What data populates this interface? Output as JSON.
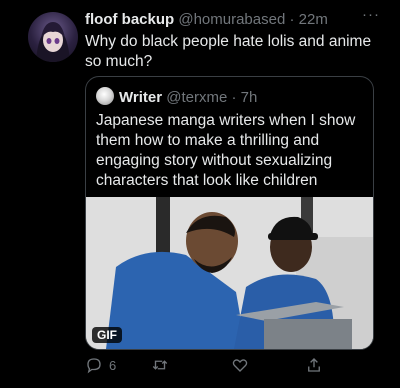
{
  "tweet": {
    "author_name": "floof backup",
    "author_handle": "@homurabased",
    "separator": " · ",
    "time": "22m",
    "more_icon": "···",
    "text": "Why do black people hate lolis and anime so much?"
  },
  "quote": {
    "author_name": "Writer",
    "author_handle": "@terxme",
    "separator": " · ",
    "time": "7h",
    "text": "Japanese manga writers when I show them how to make a thrilling and engaging story without sexualizing characters that look like children",
    "media_badge": "GIF"
  },
  "actions": {
    "reply_count": "6",
    "icons": [
      "reply-icon",
      "retweet-icon",
      "like-icon",
      "share-icon"
    ]
  }
}
